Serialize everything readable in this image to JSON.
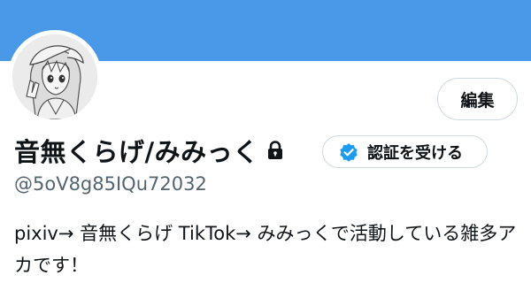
{
  "profile": {
    "display_name": "音無くらげ/みみっく",
    "handle": "@5oV8g85IQu72032",
    "bio": "pixiv→ 音無くらげ TikTok→ みみっくで活動している雑多アカです！",
    "protected_icon": "lock-icon",
    "avatar_icon": "anime-character-sketch"
  },
  "buttons": {
    "edit_label": "編集",
    "verify_label": "認証を受ける",
    "verify_icon": "verified-badge-icon"
  },
  "colors": {
    "banner": "#4a99e9",
    "verified_badge": "#1d9bf0",
    "secondary_text": "#536471",
    "button_border": "#cfd9de"
  }
}
